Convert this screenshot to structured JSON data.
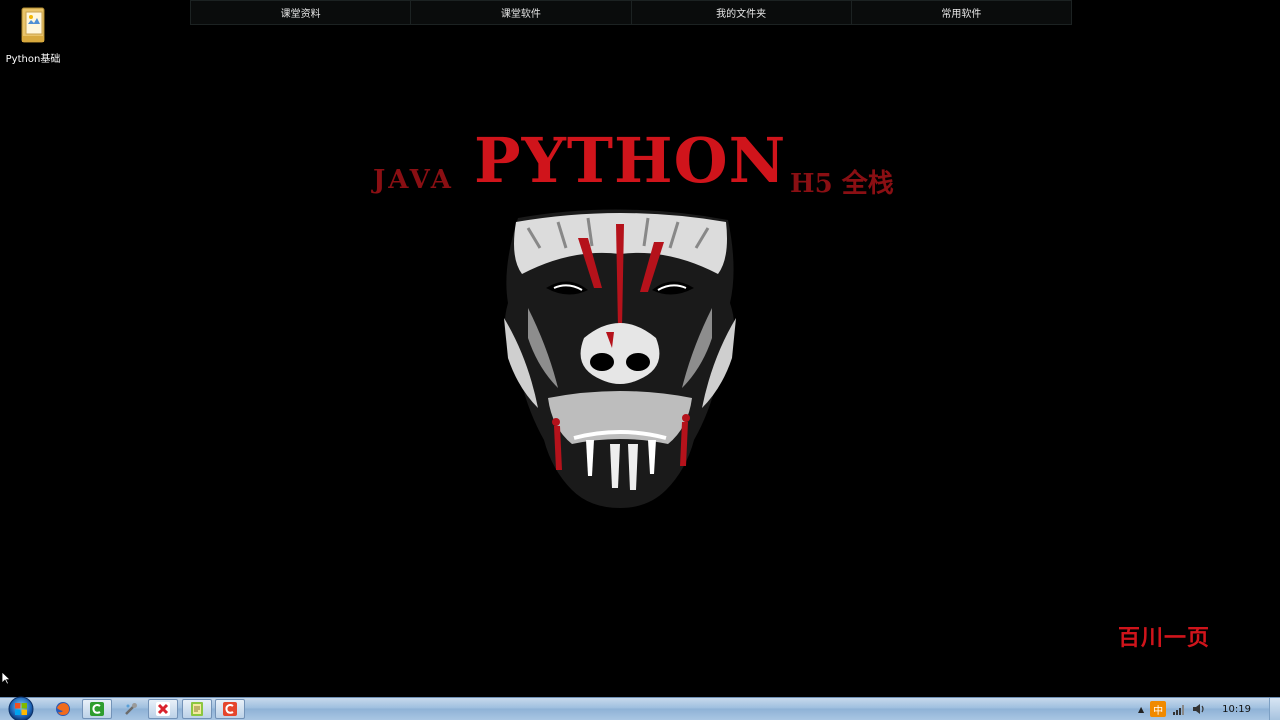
{
  "top_bar": {
    "items": [
      {
        "label": "课堂资料"
      },
      {
        "label": "课堂软件"
      },
      {
        "label": "我的文件夹"
      },
      {
        "label": "常用软件"
      }
    ]
  },
  "desktop": {
    "icons": [
      {
        "label": "Python基础",
        "icon": "folder-icon"
      }
    ]
  },
  "wallpaper": {
    "title_left": "JAVA",
    "title_main": "PYTHON",
    "title_right": "H5 全栈",
    "brand": "百川一页"
  },
  "taskbar": {
    "start": "windows-start-icon",
    "pinned": [
      {
        "name": "firefox-icon",
        "active": false
      },
      {
        "name": "camtasia-green-icon",
        "active": true
      },
      {
        "name": "tool-icon",
        "active": false
      },
      {
        "name": "xmind-icon",
        "active": true
      },
      {
        "name": "notepad-icon",
        "active": true
      },
      {
        "name": "camtasia-red-icon",
        "active": true
      }
    ],
    "tray": {
      "show_hidden": "▲",
      "ime": "中",
      "clock": "10:19"
    }
  },
  "colors": {
    "accent_red": "#d0141b",
    "taskbar": "#a9c6e3",
    "background": "#000000"
  }
}
